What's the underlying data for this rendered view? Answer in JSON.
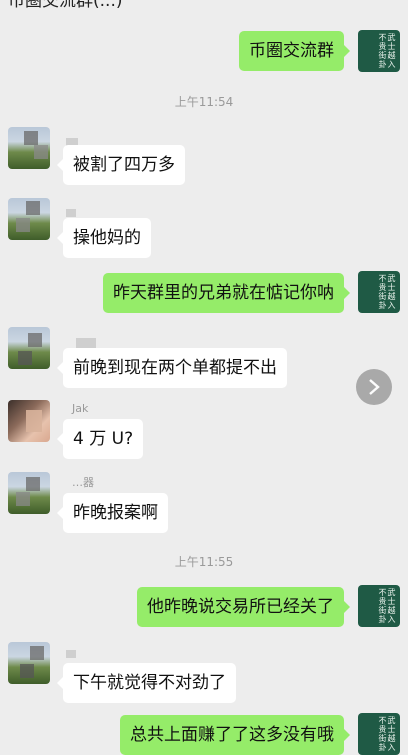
{
  "header": {
    "title": "币圈交流群(...)"
  },
  "timestamps": [
    "上午11:54",
    "上午11:55"
  ],
  "messages": [
    {
      "side": "out",
      "text": "币圈交流群"
    },
    {
      "side": "in",
      "text": "被割了四万多"
    },
    {
      "side": "in",
      "text": "操他妈的"
    },
    {
      "side": "out",
      "text": "昨天群里的兄弟就在惦记你呐"
    },
    {
      "side": "in",
      "text": "前晚到现在两个单都提不出"
    },
    {
      "side": "in",
      "sender": "Jak",
      "text": "4 万 U?"
    },
    {
      "side": "in",
      "sender": "…器",
      "text": "昨晚报案啊"
    },
    {
      "side": "out",
      "text": "他昨晚说交易所已经关了"
    },
    {
      "side": "in",
      "text": "下午就觉得不对劲了"
    },
    {
      "side": "out",
      "text": "总共上面赚了了这多没有哦"
    }
  ],
  "avatar_self": {
    "calligraphy": "武士越入不贵街卦"
  },
  "icons": {
    "forward": "chevron-right-icon"
  }
}
